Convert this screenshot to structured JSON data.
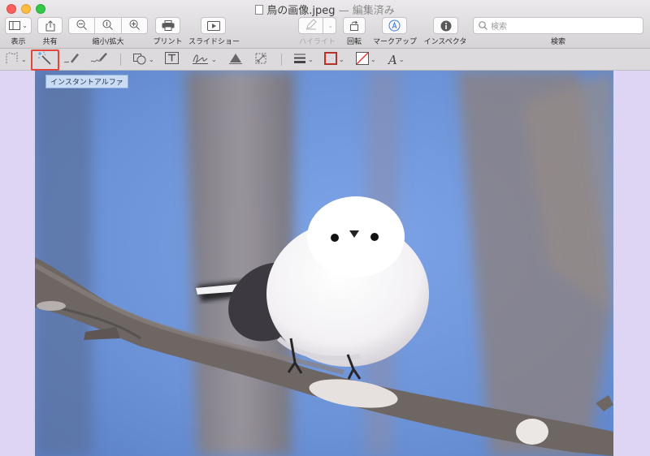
{
  "window": {
    "title": "鳥の画像.jpeg",
    "title_suffix": "— 編集済み"
  },
  "toolbar": {
    "view_label": "表示",
    "share_label": "共有",
    "zoom_label": "縮小/拡大",
    "print_label": "プリント",
    "slideshow_label": "スライドショー",
    "highlight_label": "ハイライト",
    "rotate_label": "回転",
    "markup_label": "マークアップ",
    "inspector_label": "インスペクタ",
    "search_label": "検索",
    "search_placeholder": "検索"
  },
  "markup_toolbar": {
    "tooltip": "インスタントアルファ"
  },
  "icons": [
    "sidebar-icon",
    "share-icon",
    "zoom-out-icon",
    "zoom-actual-icon",
    "zoom-in-icon",
    "print-icon",
    "slideshow-icon",
    "pen-icon",
    "rotate-icon",
    "markup-icon",
    "info-icon",
    "search-icon",
    "selection-icon",
    "instant-alpha-icon",
    "sketch-icon",
    "draw-icon",
    "shapes-icon",
    "text-icon",
    "sign-icon",
    "adjust-color-icon",
    "adjust-size-icon",
    "shape-style-icon",
    "border-color-icon",
    "fill-color-icon",
    "text-style-icon"
  ],
  "colors": {
    "accent_red": "#e0463b",
    "tooltip_bg": "#c9dcf3",
    "sky": "#6b92d6",
    "background": "#ded4f3"
  }
}
